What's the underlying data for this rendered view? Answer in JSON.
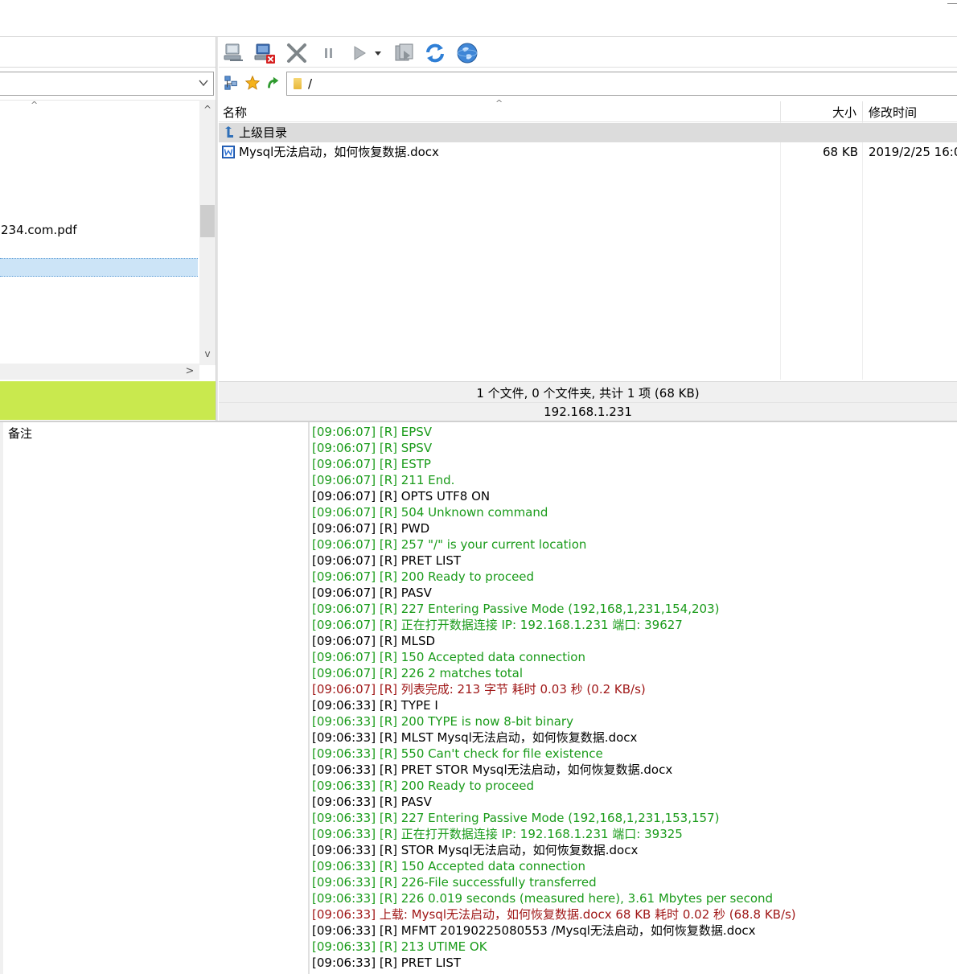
{
  "left_pane": {
    "file_name_fragment": "234.com.pdf",
    "scroll_up_arrow": "^",
    "scroll_down_arrow": "v",
    "scroll_right_arrow": ">"
  },
  "toolbar": {
    "icons": [
      "connect-icon",
      "disconnect-icon",
      "cancel-icon",
      "pause-icon",
      "play-icon",
      "dropdown-icon",
      "transfer-queue-icon",
      "refresh-icon",
      "globe-icon"
    ]
  },
  "address": {
    "path": "/"
  },
  "file_list": {
    "columns": {
      "name": "名称",
      "size": "大小",
      "modified": "修改时间"
    },
    "sort_indicator": "^",
    "rows": [
      {
        "name": "上级目录",
        "size": "",
        "modified": "",
        "kind": "parent-dir"
      },
      {
        "name": "Mysql无法启动，如何恢复数据.docx",
        "size": "68 KB",
        "modified": "2019/2/25 16:0",
        "kind": "word-document"
      }
    ]
  },
  "status": {
    "summary": "1 个文件, 0 个文件夹, 共计 1 项 (68 KB)",
    "host": "192.168.1.231"
  },
  "notes": {
    "label": "备注"
  },
  "colors": {
    "left_status_bg": "#c9e94e",
    "log_green": "#1a9b1a",
    "log_black": "#000000",
    "log_red": "#a01818"
  },
  "log": [
    {
      "text": "[09:06:07]  [R]  EPSV",
      "color": "green"
    },
    {
      "text": "[09:06:07]  [R]  SPSV",
      "color": "green"
    },
    {
      "text": "[09:06:07]  [R]  ESTP",
      "color": "green"
    },
    {
      "text": "[09:06:07]  [R] 211 End.",
      "color": "green"
    },
    {
      "text": "[09:06:07]  [R] OPTS UTF8 ON",
      "color": "black"
    },
    {
      "text": "[09:06:07]  [R] 504 Unknown command",
      "color": "green"
    },
    {
      "text": "[09:06:07]  [R] PWD",
      "color": "black"
    },
    {
      "text": "[09:06:07]  [R] 257 \"/\" is your current location",
      "color": "green"
    },
    {
      "text": "[09:06:07]  [R] PRET LIST",
      "color": "black"
    },
    {
      "text": "[09:06:07]  [R] 200 Ready to proceed",
      "color": "green"
    },
    {
      "text": "[09:06:07]  [R] PASV",
      "color": "black"
    },
    {
      "text": "[09:06:07]  [R] 227 Entering Passive Mode (192,168,1,231,154,203)",
      "color": "green"
    },
    {
      "text": "[09:06:07]  [R] 正在打开数据连接 IP: 192.168.1.231 端口: 39627",
      "color": "green"
    },
    {
      "text": "[09:06:07]  [R] MLSD",
      "color": "black"
    },
    {
      "text": "[09:06:07]  [R] 150 Accepted data connection",
      "color": "green"
    },
    {
      "text": "[09:06:07]  [R] 226 2 matches total",
      "color": "green"
    },
    {
      "text": "[09:06:07]  [R] 列表完成: 213 字节 耗时 0.03 秒 (0.2 KB/s)",
      "color": "red"
    },
    {
      "text": "[09:06:33]  [R] TYPE I",
      "color": "black"
    },
    {
      "text": "[09:06:33]  [R] 200 TYPE is now 8-bit binary",
      "color": "green"
    },
    {
      "text": "[09:06:33]  [R] MLST Mysql无法启动，如何恢复数据.docx",
      "color": "black"
    },
    {
      "text": "[09:06:33]  [R] 550 Can't check for file existence",
      "color": "green"
    },
    {
      "text": "[09:06:33]  [R] PRET STOR Mysql无法启动，如何恢复数据.docx",
      "color": "black"
    },
    {
      "text": "[09:06:33]  [R] 200 Ready to proceed",
      "color": "green"
    },
    {
      "text": "[09:06:33]  [R] PASV",
      "color": "black"
    },
    {
      "text": "[09:06:33]  [R] 227 Entering Passive Mode (192,168,1,231,153,157)",
      "color": "green"
    },
    {
      "text": "[09:06:33]  [R] 正在打开数据连接 IP: 192.168.1.231 端口: 39325",
      "color": "green"
    },
    {
      "text": "[09:06:33]  [R] STOR Mysql无法启动，如何恢复数据.docx",
      "color": "black"
    },
    {
      "text": "[09:06:33]  [R] 150 Accepted data connection",
      "color": "green"
    },
    {
      "text": "[09:06:33]  [R] 226-File successfully transferred",
      "color": "green"
    },
    {
      "text": "[09:06:33]  [R] 226 0.019 seconds (measured here), 3.61 Mbytes per second",
      "color": "green"
    },
    {
      "text": "[09:06:33]  上载: Mysql无法启动，如何恢复数据.docx 68 KB 耗时 0.02 秒 (68.8 KB/s)",
      "color": "red"
    },
    {
      "text": "[09:06:33]  [R] MFMT 20190225080553 /Mysql无法启动，如何恢复数据.docx",
      "color": "black"
    },
    {
      "text": "[09:06:33]  [R] 213 UTIME OK",
      "color": "green"
    },
    {
      "text": "[09:06:33]  [R] PRET LIST",
      "color": "black"
    }
  ]
}
